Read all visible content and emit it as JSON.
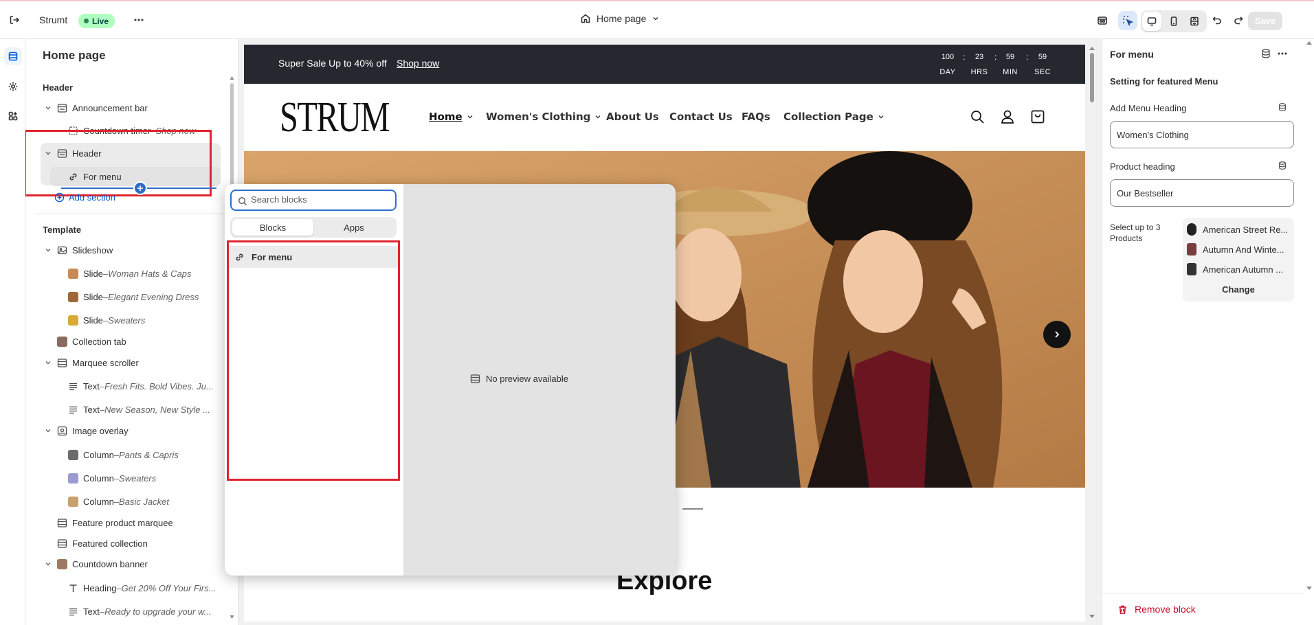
{
  "topbar": {
    "store_name": "Strumt",
    "status_badge": "Live",
    "page_selector": "Home page",
    "save_label": "Save"
  },
  "sidebar": {
    "title": "Home page",
    "header_section_label": "Header",
    "header_items": [
      {
        "label": "Announcement bar",
        "sub": ""
      },
      {
        "label": "Countdown timer",
        "sub": "Shop now"
      },
      {
        "label": "Header",
        "sub": ""
      },
      {
        "label": "For menu",
        "sub": ""
      }
    ],
    "add_section": "Add section",
    "template_label": "Template",
    "template_items": [
      {
        "label": "Slideshow",
        "sub": ""
      },
      {
        "label": "Slide",
        "sub": "Woman Hats & Caps"
      },
      {
        "label": "Slide",
        "sub": "Elegant Evening Dress"
      },
      {
        "label": "Slide",
        "sub": "Sweaters"
      },
      {
        "label": "Collection tab",
        "sub": ""
      },
      {
        "label": "Marquee scroller",
        "sub": ""
      },
      {
        "label": "Text",
        "sub": "Fresh Fits. Bold Vibes. Ju..."
      },
      {
        "label": "Text",
        "sub": "New Season, New Style ..."
      },
      {
        "label": "Image overlay",
        "sub": ""
      },
      {
        "label": "Column",
        "sub": "Pants & Capris"
      },
      {
        "label": "Column",
        "sub": "Sweaters"
      },
      {
        "label": "Column",
        "sub": "Basic Jacket"
      },
      {
        "label": "Feature product marquee",
        "sub": ""
      },
      {
        "label": "Featured collection",
        "sub": ""
      },
      {
        "label": "Countdown banner",
        "sub": ""
      },
      {
        "label": "Heading",
        "sub": "Get 20% Off Your Firs..."
      },
      {
        "label": "Text",
        "sub": "Ready to upgrade your w..."
      }
    ],
    "separator": " – "
  },
  "preview": {
    "announcement": "Super Sale Up to 40% off",
    "announcement_link": "Shop now",
    "countdown": [
      {
        "value": "100",
        "label": "DAY"
      },
      {
        "value": "23",
        "label": "HRS"
      },
      {
        "value": "59",
        "label": "MIN"
      },
      {
        "value": "59",
        "label": "SEC"
      }
    ],
    "colon": ":",
    "logo": "STRUM",
    "nav": [
      "Home",
      "Women's Clothing",
      "About Us",
      "Contact Us",
      "FAQs",
      "Collection Page"
    ],
    "explore_heading": "Explore"
  },
  "popover": {
    "search_placeholder": "Search blocks",
    "tabs": [
      "Blocks",
      "Apps"
    ],
    "block_item": "For menu",
    "no_preview": "No preview available"
  },
  "right_panel": {
    "title": "For menu",
    "setting_heading": "Setting for featured Menu",
    "menu_heading_label": "Add Menu Heading",
    "menu_heading_value": "Women's Clothing",
    "product_heading_label": "Product heading",
    "product_heading_value": "Our Bestseller",
    "select_products_label": "Select up to 3 Products",
    "products": [
      "American Street Re...",
      "Autumn And Winte...",
      "American Autumn ..."
    ],
    "change_label": "Change",
    "remove_block": "Remove block"
  },
  "colors": {
    "accent": "#2c6ecb",
    "highlight_box": "#e0232e",
    "live_badge": "#affebf",
    "announcement_bg": "#25292f",
    "remove": "#c70a24"
  },
  "icons": [
    "exit-icon",
    "more-horizontal-icon",
    "home-icon",
    "chevron-down-icon",
    "store-icon",
    "inspector-icon",
    "desktop-icon",
    "mobile-icon",
    "fullwidth-icon",
    "undo-icon",
    "redo-icon",
    "sections-icon",
    "settings-icon",
    "apps-icon",
    "search-icon",
    "account-icon",
    "cart-icon",
    "link-icon",
    "database-icon",
    "trash-icon"
  ]
}
